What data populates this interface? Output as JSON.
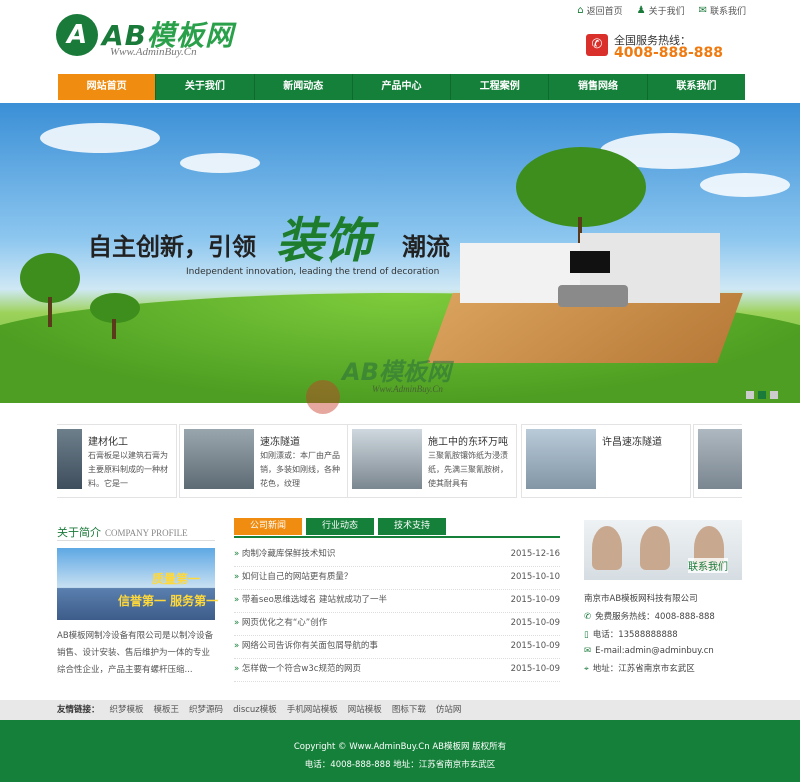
{
  "header": {
    "logo_mark": "A",
    "logo_text_a": "AB",
    "logo_text_b": "模板网",
    "logo_sub": "Www.AdminBuy.Cn",
    "toplinks": [
      "返回首页",
      "关于我们",
      "联系我们"
    ],
    "hotline_label": "全国服务热线：",
    "hotline_number": "4008-888-888"
  },
  "nav": [
    "网站首页",
    "关于我们",
    "新闻动态",
    "产品中心",
    "工程案例",
    "销售网络",
    "联系我们"
  ],
  "banner": {
    "title_a": "自主创新，引领",
    "title_accent": "装饰",
    "title_b": "潮流",
    "subtitle": "Independent innovation, leading the trend of decoration",
    "watermark": "AB模板网",
    "watermark_sub": "Www.AdminBuy.Cn"
  },
  "products": [
    {
      "title": "建材化工",
      "desc": "石膏板是以建筑石膏为主要原料制成的一种材料。它是一"
    },
    {
      "title": "速冻隧道",
      "desc": "如刚漂或：本厂由产品销，多装如刚线，各种花色，纹理"
    },
    {
      "title": "施工中的东环万吨",
      "desc": "三聚氰胺镶饰纸为浸渍纸，先满三聚氰胺树，使其耐具有"
    },
    {
      "title": "许昌速冻隧道",
      "desc": ""
    }
  ],
  "about": {
    "title": "关于简介",
    "title_en": "COMPANY PROFILE",
    "badge_a": "质量第一",
    "badge_b": "信誉第一 服务第一",
    "text": "AB模板网制冷设备有限公司是以制冷设备销售、设计安装、售后维护为一体的专业综合性企业，产品主要有螺杆压缩..."
  },
  "tabs": [
    "公司新闻",
    "行业动态",
    "技术支持"
  ],
  "news": [
    {
      "title": "肉制冷藏库保鲜技术知识",
      "date": "2015-12-16"
    },
    {
      "title": "如何让自己的网站更有质量？",
      "date": "2015-10-10"
    },
    {
      "title": "带着seo思维选域名 建站就成功了一半",
      "date": "2015-10-09"
    },
    {
      "title": "网页优化之有“心”创作",
      "date": "2015-10-09"
    },
    {
      "title": "网络公司告诉你有关面包屑导航的事",
      "date": "2015-10-09"
    },
    {
      "title": "怎样做一个符合w3c规范的网页",
      "date": "2015-10-09"
    }
  ],
  "contact": {
    "label": "联系我们",
    "company": "南京市AB模板网科技有限公司",
    "free_line": "免费服务热线：4008-888-888",
    "phone": "电话：13588888888",
    "email": "E-mail:admin@adminbuy.cn",
    "address": "地址：江苏省南京市玄武区"
  },
  "links": {
    "label": "友情链接：",
    "items": [
      "织梦模板",
      "模板王",
      "织梦源码",
      "discuz模板",
      "手机网站模板",
      "网站模板",
      "图标下载",
      "仿站网"
    ]
  },
  "footer": {
    "copyright": "Copyright © Www.AdminBuy.Cn AB模板网 版权所有",
    "contact": "电话：4008-888-888    地址：江苏省南京市玄武区"
  },
  "colors": {
    "brand": "#15803a",
    "accent": "#f08c0f",
    "hotline": "#f07a10"
  }
}
